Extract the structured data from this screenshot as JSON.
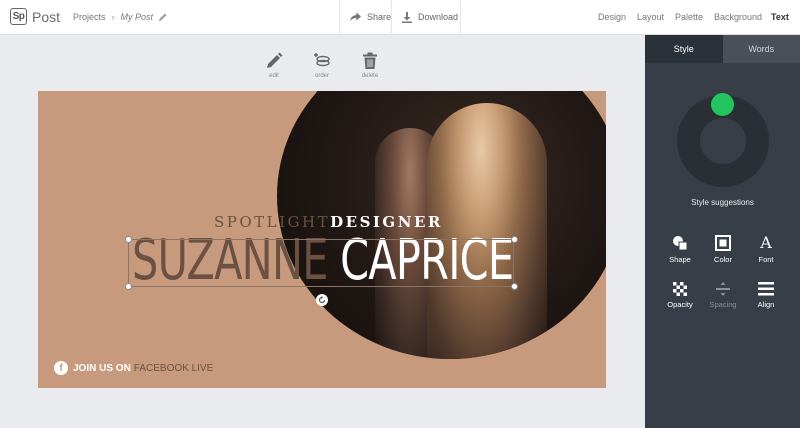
{
  "app": {
    "logo_badge": "Sp",
    "logo_text": "Post"
  },
  "breadcrumb": {
    "projects": "Projects",
    "separator": "›",
    "current": "My Post"
  },
  "toolbar": {
    "share": "Share",
    "download": "Download"
  },
  "nav": [
    "Design",
    "Layout",
    "Palette",
    "Background",
    "Text"
  ],
  "nav_active": "Text",
  "tools": {
    "edit": "edit",
    "order": "order",
    "delete": "delete"
  },
  "canvas": {
    "line1_a": "SPOTLIGHT",
    "line1_b": "DESIGNER",
    "line2_a": "SUZANNE",
    "line2_b": "CAPRICE",
    "fb_icon": "f",
    "fb_a": "JOIN US ON",
    "fb_b": "FACEBOOK LIVE",
    "background_color": "#c79a7d"
  },
  "panel": {
    "tabs": [
      "Style",
      "Words"
    ],
    "active_tab": "Style",
    "suggestions_label": "Style suggestions",
    "accent": "#22c55e",
    "tools": [
      "Shape",
      "Color",
      "Font",
      "Opacity",
      "Spacing",
      "Align"
    ],
    "font_glyph": "A"
  }
}
